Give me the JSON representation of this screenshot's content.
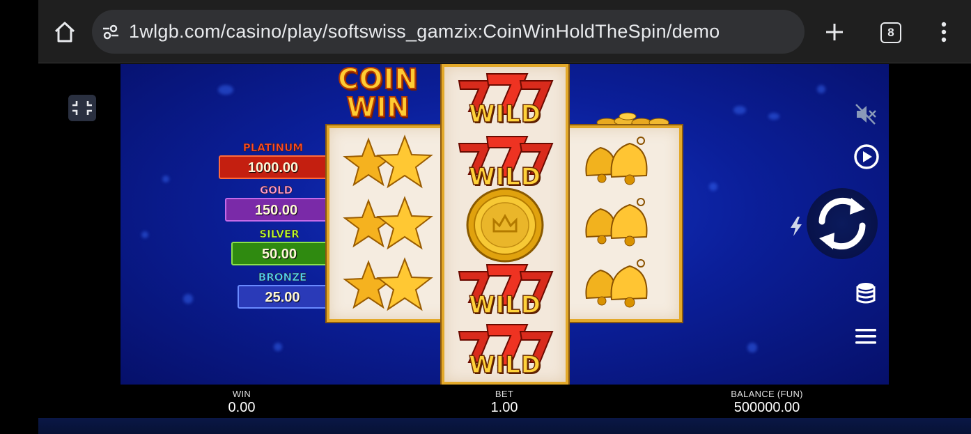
{
  "browser": {
    "url": "1wlgb.com/casino/play/softswiss_gamzix:CoinWinHoldTheSpin/demo",
    "tab_count": "8",
    "icons": [
      "home-icon",
      "site-settings-icon",
      "new-tab-icon",
      "tab-switcher-icon",
      "more-menu-icon"
    ]
  },
  "game": {
    "logo": {
      "line1": "COIN",
      "line2": "WIN"
    },
    "jackpots": [
      {
        "name": "PLATINUM",
        "value": "1000.00",
        "title_color": "#ff4a2a",
        "box_bg": "#c41f10",
        "box_border": "#ff6a3a"
      },
      {
        "name": "GOLD",
        "value": "150.00",
        "title_color": "#ff9ad8",
        "box_bg": "#7a2aa8",
        "box_border": "#c56ae8"
      },
      {
        "name": "SILVER",
        "value": "50.00",
        "title_color": "#b6ff3a",
        "box_bg": "#2f8a10",
        "box_border": "#8be04a"
      },
      {
        "name": "BRONZE",
        "value": "25.00",
        "title_color": "#4ad0ff",
        "box_bg": "#2a3ab8",
        "box_border": "#6a8aff"
      }
    ],
    "reels": {
      "reel1": [
        "stars",
        "stars",
        "stars"
      ],
      "reel2": [
        "wild",
        "wild",
        "coin",
        "wild",
        "wild"
      ],
      "reel3": [
        "bells",
        "bells",
        "bells"
      ],
      "wild_text": "WILD"
    },
    "controls": [
      "sound-off-icon",
      "autoplay-icon",
      "spin-icon",
      "turbo-icon",
      "bet-coins-icon",
      "menu-icon"
    ]
  },
  "footer": {
    "win": {
      "label": "WIN",
      "value": "0.00"
    },
    "bet": {
      "label": "BET",
      "value": "1.00"
    },
    "balance": {
      "label": "BALANCE (FUN)",
      "value": "500000.00"
    }
  }
}
